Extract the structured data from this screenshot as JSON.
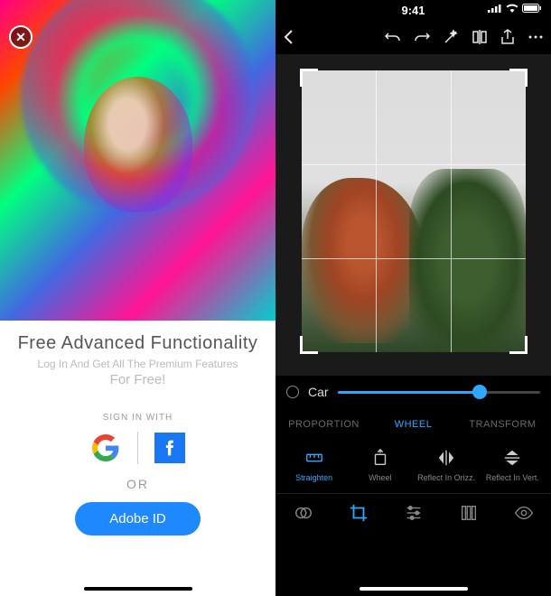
{
  "left": {
    "close_glyph": "✕",
    "title": "Free Advanced Functionality",
    "subtitle": "Log In And Get All The Premium Features",
    "for_free": "For Free!",
    "signin_with": "SIGN IN WITH",
    "or": "OR",
    "adobe_button": "Adobe ID",
    "google_aria": "Google",
    "facebook_aria": "Facebook"
  },
  "right": {
    "time": "9:41",
    "slider": {
      "label": "Car",
      "value_pct": 70
    },
    "tabs": {
      "proportion": "PROPORTION",
      "wheel": "WHEEL",
      "transform": "TRANSFORM",
      "active": "wheel"
    },
    "tools": {
      "straighten": "Straighten",
      "wheel": "Wheel",
      "reflect_h": "Reflect In Orizz.",
      "reflect_v": "Reflect In Vert."
    },
    "bottom_icons": [
      "overlap",
      "crop",
      "sliders",
      "channels",
      "eye"
    ],
    "bottom_active": "crop"
  }
}
